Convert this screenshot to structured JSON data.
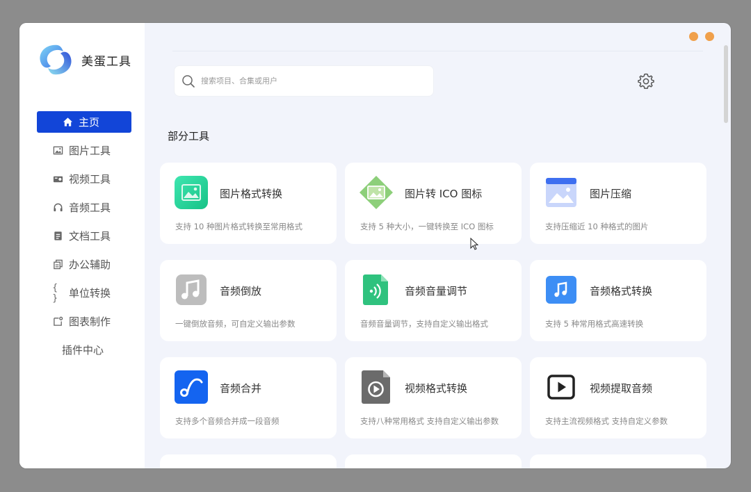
{
  "app": {
    "title": "美蛋工具"
  },
  "sidebar": {
    "items": [
      {
        "label": "主页",
        "icon": "home-icon"
      },
      {
        "label": "图片工具",
        "icon": "image-icon"
      },
      {
        "label": "视频工具",
        "icon": "video-icon"
      },
      {
        "label": "音频工具",
        "icon": "headphones-icon"
      },
      {
        "label": "文档工具",
        "icon": "document-icon"
      },
      {
        "label": "办公辅助",
        "icon": "copy-icon"
      },
      {
        "label": "单位转换",
        "icon": "braces-icon"
      },
      {
        "label": "图表制作",
        "icon": "chart-icon"
      },
      {
        "label": "插件中心"
      }
    ]
  },
  "search": {
    "placeholder": "搜索项目、合集或用户"
  },
  "section": {
    "title": "部分工具"
  },
  "tools": [
    {
      "title": "图片格式转换",
      "desc": "支持 10 种图片格式转换至常用格式",
      "icon": "image-convert-icon",
      "color": "#27d39a"
    },
    {
      "title": "图片转 ICO 图标",
      "desc": "支持 5 种大小，一键转换至 ICO 图标",
      "icon": "image-to-ico-icon",
      "color": "#8dcf7a"
    },
    {
      "title": "图片压缩",
      "desc": "支持压缩近 10 种格式的图片",
      "icon": "image-compress-icon",
      "color": "#4a7cf0"
    },
    {
      "title": "音频倒放",
      "desc": "一键倒放音频，可自定义输出参数",
      "icon": "audio-reverse-icon",
      "color": "#bdbdbd"
    },
    {
      "title": "音频音量调节",
      "desc": "音频音量调节，支持自定义输出格式",
      "icon": "audio-volume-icon",
      "color": "#2fc27e"
    },
    {
      "title": "音频格式转换",
      "desc": "支持 5 种常用格式高速转换",
      "icon": "audio-convert-icon",
      "color": "#3d8ef5"
    },
    {
      "title": "音频合并",
      "desc": "支持多个音频合并成一段音频",
      "icon": "audio-merge-icon",
      "color": "#1464f0"
    },
    {
      "title": "视频格式转换",
      "desc": "支持八种常用格式 支持自定义输出参数",
      "icon": "video-convert-icon",
      "color": "#6b6b6b"
    },
    {
      "title": "视频提取音频",
      "desc": "支持主流视频格式 支持自定义参数",
      "icon": "video-extract-audio-icon",
      "color": "#222222"
    }
  ],
  "colors": {
    "accent": "#1245d8",
    "window_dots": "#f0a04b"
  }
}
